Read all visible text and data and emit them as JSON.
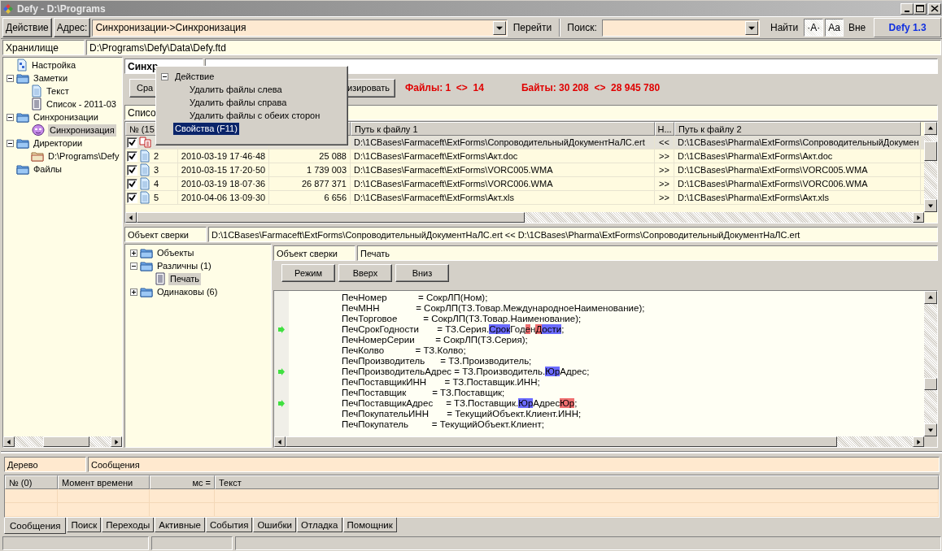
{
  "window": {
    "title": "Defy - D:\\Programs"
  },
  "toolbar": {
    "action_button": "Действие",
    "address_label": "Адрес:",
    "address_value": "Синхронизации->Синхронизация",
    "go_button": "Перейти",
    "search_label": "Поиск:",
    "find_button": "Найти",
    "toggles": [
      {
        "label": "·A·",
        "on": true
      },
      {
        "label": "Aa",
        "on": true
      },
      {
        "label": "Вне",
        "on": false
      }
    ],
    "version": "Defy 1.3"
  },
  "storage": {
    "label": "Хранилище",
    "path": "D:\\Programs\\Defy\\Data\\Defy.ftd"
  },
  "sidebar": {
    "items": [
      {
        "label": "Настройка",
        "kind": "settings",
        "selected": false
      },
      {
        "label": "Заметки",
        "kind": "folder",
        "expanded": true,
        "selected": false,
        "children": [
          {
            "label": "Текст",
            "kind": "page",
            "selected": false
          },
          {
            "label": "Список - 2011-03",
            "kind": "list",
            "selected": false
          }
        ]
      },
      {
        "label": "Синхронизации",
        "kind": "folder",
        "expanded": true,
        "selected": false,
        "children": [
          {
            "label": "Синхронизация",
            "kind": "mask",
            "selected": true
          }
        ]
      },
      {
        "label": "Директории",
        "kind": "folder",
        "expanded": true,
        "selected": false,
        "children": [
          {
            "label": "D:\\Programs\\Defy",
            "kind": "dir",
            "selected": false
          }
        ]
      },
      {
        "label": "Файлы",
        "kind": "folder",
        "selected": false
      }
    ]
  },
  "sync": {
    "tab": "Синхр",
    "buttons": [
      "Сра",
      "изировать"
    ],
    "files_stat": "Файлы: 1  <>  14",
    "bytes_stat": "Байты: 30 208  <>  28 945 780",
    "list_label": "Списо",
    "table": {
      "columns": [
        "№ (15",
        "Путь к файлу 1",
        "Н...",
        "Путь к файлу 2"
      ],
      "rows": [
        {
          "checked": true,
          "selected": true,
          "kind": "pair",
          "path1": "D:\\1CBases\\Farmaceft\\ExtForms\\СопроводительныйДокументНаЛС.ert",
          "direction": "<<",
          "path2": "D:\\1CBases\\Pharma\\ExtForms\\СопроводительныйДокумен"
        },
        {
          "checked": true,
          "selected": false,
          "kind": "page",
          "num": "2",
          "date": "2010-03-19 17·46·48",
          "size": "25 088",
          "path1": "D:\\1CBases\\Farmaceft\\ExtForms\\Акт.doc",
          "direction": ">>",
          "path2": "D:\\1CBases\\Pharma\\ExtForms\\Акт.doc"
        },
        {
          "checked": true,
          "selected": false,
          "kind": "page",
          "num": "3",
          "date": "2010-03-15 17·20·50",
          "size": "1 739 003",
          "path1": "D:\\1CBases\\Farmaceft\\ExtForms\\VORC005.WMA",
          "direction": ">>",
          "path2": "D:\\1CBases\\Pharma\\ExtForms\\VORC005.WMA"
        },
        {
          "checked": true,
          "selected": false,
          "kind": "page",
          "num": "4",
          "date": "2010-03-19 18·07·36",
          "size": "26 877 371",
          "path1": "D:\\1CBases\\Farmaceft\\ExtForms\\VORC006.WMA",
          "direction": ">>",
          "path2": "D:\\1CBases\\Pharma\\ExtForms\\VORC006.WMA"
        },
        {
          "checked": true,
          "selected": false,
          "kind": "page",
          "num": "5",
          "date": "2010-04-06 13·09·30",
          "size": "6 656",
          "path1": "D:\\1CBases\\Farmaceft\\ExtForms\\Акт.xls",
          "direction": ">>",
          "path2": "D:\\1CBases\\Pharma\\ExtForms\\Акт.xls"
        }
      ]
    }
  },
  "popup_menu": {
    "items": [
      {
        "label": "Действие",
        "expanded": true,
        "selected": false,
        "children": [
          {
            "label": "Удалить файлы слева",
            "selected": false
          },
          {
            "label": "Удалить файлы справа",
            "selected": false
          },
          {
            "label": "Удалить файлы с обеих сторон",
            "selected": false
          }
        ]
      },
      {
        "label": "Свойства (F11)",
        "selected": true
      }
    ]
  },
  "object": {
    "label": "Объект сверки",
    "value": "D:\\1CBases\\Farmaceft\\ExtForms\\СопроводительныйДокументНаЛС.ert << D:\\1CBases\\Pharma\\ExtForms\\СопроводительныйДокументНаЛС.ert"
  },
  "diff_tree": {
    "items": [
      {
        "label": "Объекты",
        "kind": "folder",
        "expanded": false,
        "selected": false
      },
      {
        "label": "Различны (1)",
        "kind": "folder",
        "expanded": true,
        "selected": false,
        "children": [
          {
            "label": "Печать",
            "kind": "list",
            "selected": true
          }
        ]
      },
      {
        "label": "Одинаковы (6)",
        "kind": "folder",
        "expanded": false,
        "selected": false
      }
    ]
  },
  "compare": {
    "label": "Объект сверки",
    "value": "Печать",
    "buttons": [
      "Режим",
      "Вверх",
      "Вниз"
    ],
    "lines": [
      {
        "marker": false,
        "parts": [
          {
            "text": "ПечНомер            = СокрЛП(Ном);"
          }
        ]
      },
      {
        "marker": false,
        "parts": [
          {
            "text": "ПечМНН              = СокрЛП(ТЗ.Товар.МеждународноеНаименование);"
          }
        ]
      },
      {
        "marker": false,
        "parts": [
          {
            "text": "ПечТорговое          = СокрЛП(ТЗ.Товар.Наименование);"
          }
        ]
      },
      {
        "marker": true,
        "parts": [
          {
            "text": "ПечСрокГодности       = ТЗ.Серия."
          },
          {
            "text": "Срок",
            "color": "#6b6bff"
          },
          {
            "text": "Год"
          },
          {
            "text": "е",
            "color": "#f07070"
          },
          {
            "text": "н"
          },
          {
            "text": "Д",
            "color": "#f07070"
          },
          {
            "text": "ости",
            "color": "#6b6bff"
          },
          {
            "text": ";"
          }
        ]
      },
      {
        "marker": false,
        "parts": [
          {
            "text": "ПечНомерСерии        = СокрЛП(ТЗ.Серия);"
          }
        ]
      },
      {
        "marker": false,
        "parts": [
          {
            "text": "ПечКолво            = ТЗ.Колво;"
          }
        ]
      },
      {
        "marker": false,
        "parts": [
          {
            "text": "ПечПроизводитель      = ТЗ.Производитель;"
          }
        ]
      },
      {
        "marker": true,
        "parts": [
          {
            "text": "ПечПроизводительАдрес = ТЗ.Производитель."
          },
          {
            "text": "Юр",
            "color": "#6b6bff"
          },
          {
            "text": "Адрес;"
          }
        ]
      },
      {
        "marker": false,
        "parts": [
          {
            "text": "ПечПоставщикИНН       = ТЗ.Поставщик.ИНН;"
          }
        ]
      },
      {
        "marker": false,
        "parts": [
          {
            "text": "ПечПоставщик          = ТЗ.Поставщик;"
          }
        ]
      },
      {
        "marker": true,
        "parts": [
          {
            "text": "ПечПоставщикАдрес     = ТЗ.Поставщик."
          },
          {
            "text": "Юр",
            "color": "#6b6bff"
          },
          {
            "text": "Адрес"
          },
          {
            "text": "Юр",
            "color": "#f07070"
          },
          {
            "text": ";"
          }
        ]
      },
      {
        "marker": false,
        "parts": [
          {
            "text": "ПечПокупательИНН       = ТекущийОбъект.Клиент.ИНН;"
          }
        ]
      },
      {
        "marker": false,
        "parts": [
          {
            "text": "ПечПокупатель         = ТекущийОбъект.Клиент;"
          }
        ]
      }
    ]
  },
  "messages": {
    "tree_label": "Дерево",
    "title": "Сообщения",
    "columns": [
      "№ (0)",
      "Момент времени",
      "мс =",
      "Текст"
    ],
    "tabs": [
      {
        "label": "Сообщения",
        "selected": true
      },
      {
        "label": "Поиск",
        "selected": false
      },
      {
        "label": "Переходы",
        "selected": false
      },
      {
        "label": "Активные",
        "selected": false
      },
      {
        "label": "События",
        "selected": false
      },
      {
        "label": "Ошибки",
        "selected": false
      },
      {
        "label": "Отладка",
        "selected": false
      },
      {
        "label": "Помощник",
        "selected": false
      }
    ]
  }
}
